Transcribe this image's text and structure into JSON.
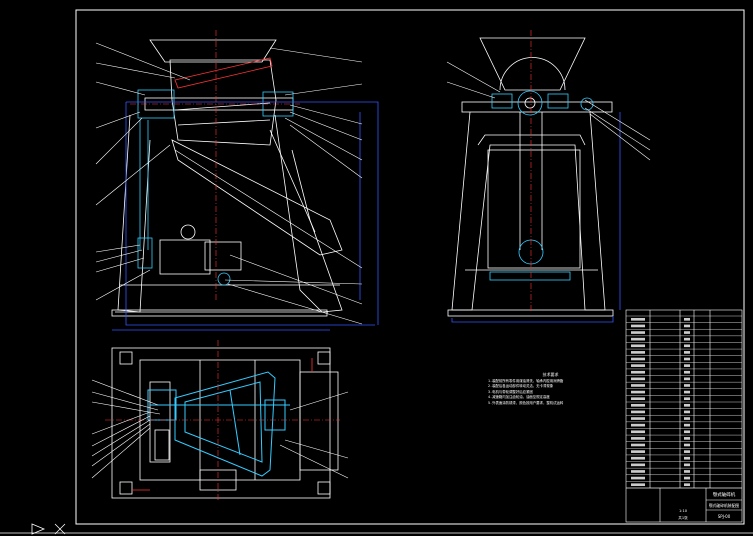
{
  "drawing": {
    "background": "#000000",
    "line_color": "#ffffff",
    "dim_color": "#3355ff",
    "hatch_color": "#33ccff",
    "accent_color": "#ff3333"
  },
  "tech_notes": {
    "title": "技术要求",
    "lines": [
      "1.装配前所有零件用煤油清洗，轴承内腔用润滑脂",
      "2.装配后各运动部件转动灵活，无卡滞现象",
      "3.电机与带轮调整好后应紧固",
      "4.减速箱内加注齿轮油，油面至规定高度",
      "5.外表面涂防锈漆，颜色按用户要求，整机试运转"
    ]
  },
  "title_block": {
    "name": "颚式破碎机",
    "name2": "颚式破碎机装配图",
    "code": "SPJ-00",
    "scale": "1:10",
    "sheet": "共1张"
  },
  "bom_rows": 26
}
